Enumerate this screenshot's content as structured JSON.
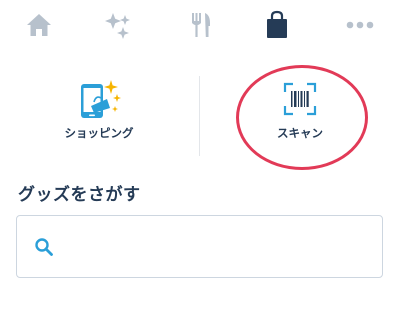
{
  "tabbar": {
    "tabs": [
      {
        "id": "home",
        "icon": "home-icon",
        "active": false
      },
      {
        "id": "magic",
        "icon": "sparkle-stars-icon",
        "active": false
      },
      {
        "id": "dining",
        "icon": "fork-knife-icon",
        "active": false
      },
      {
        "id": "shop",
        "icon": "shopping-bag-icon",
        "active": true
      },
      {
        "id": "more",
        "icon": "more-dots-icon",
        "active": false
      }
    ]
  },
  "actions": {
    "shopping": {
      "label": "ショッピング",
      "icon": "phone-shopping-icon"
    },
    "scan": {
      "label": "スキャン",
      "icon": "barcode-scan-icon"
    }
  },
  "goods": {
    "heading": "グッズをさがす",
    "search": {
      "value": "",
      "placeholder": "",
      "icon": "search-icon"
    }
  },
  "colors": {
    "navy": "#253b56",
    "inactive_icon": "#b7c1cc",
    "accent_blue": "#2b9fd8",
    "highlight_red": "#e23a57",
    "gold": "#f6b400"
  }
}
